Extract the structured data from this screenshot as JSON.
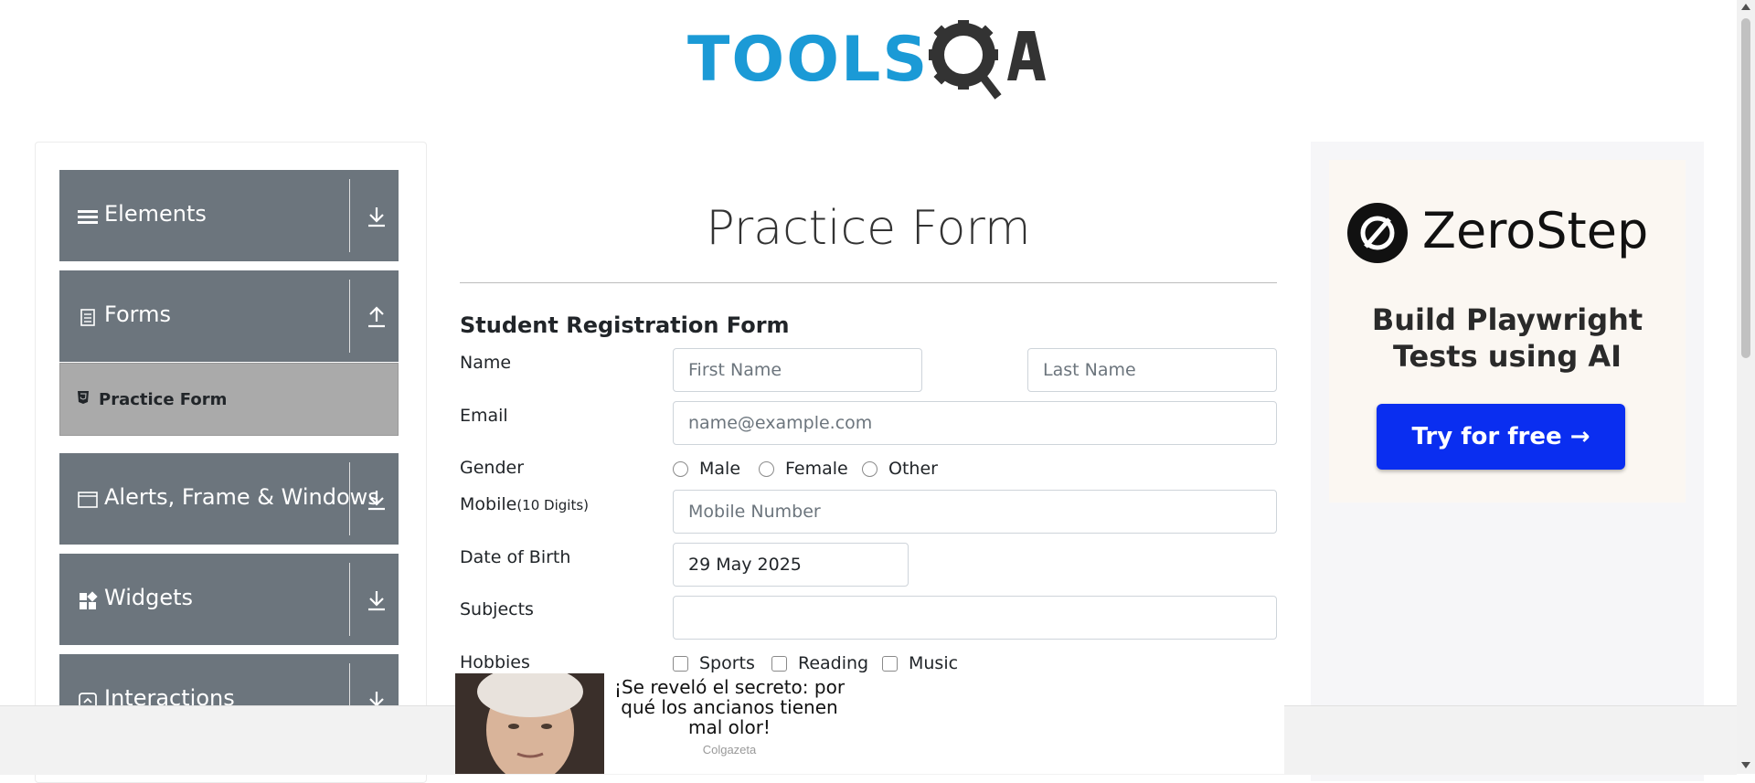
{
  "logo": {
    "text_left": "TOOLS",
    "text_right": "QA"
  },
  "sidebar": {
    "groups": [
      {
        "label": "Elements",
        "icon": "menu-icon",
        "arrow": "download-arrow-icon"
      },
      {
        "label": "Forms",
        "icon": "document-icon",
        "arrow": "upload-arrow-icon"
      },
      {
        "label": "Alerts, Frame & Windows",
        "icon": "window-icon",
        "arrow": "download-arrow-icon"
      },
      {
        "label": "Widgets",
        "icon": "widgets-icon",
        "arrow": "download-arrow-icon"
      },
      {
        "label": "Interactions",
        "icon": "interactions-icon",
        "arrow": "download-arrow-icon"
      }
    ],
    "active_item": {
      "label": "Practice Form",
      "icon": "html5-icon"
    }
  },
  "main": {
    "title": "Practice Form",
    "form_title": "Student Registration Form",
    "name_label": "Name",
    "first_name_placeholder": "First Name",
    "last_name_placeholder": "Last Name",
    "email_label": "Email",
    "email_placeholder": "name@example.com",
    "gender_label": "Gender",
    "gender_options": [
      "Male",
      "Female",
      "Other"
    ],
    "mobile_label": "Mobile",
    "mobile_hint": "(10 Digits)",
    "mobile_placeholder": "Mobile Number",
    "dob_label": "Date of Birth",
    "dob_value": "29 May 2025",
    "subjects_label": "Subjects",
    "subjects_value": "",
    "hobbies_label": "Hobbies",
    "hobbies_options": [
      "Sports",
      "Reading",
      "Music"
    ]
  },
  "ad_right": {
    "brand": "ZeroStep",
    "tagline_line1": "Build Playwright",
    "tagline_line2": "Tests using AI",
    "cta": "Try for free →"
  },
  "native_ad": {
    "headline": "¡Se reveló el secreto: por qué los ancianos tienen mal olor!",
    "source": "Colgazeta"
  },
  "colors": {
    "sidebar_group": "#6c757d",
    "active_item": "#aaaaaa",
    "logo_blue": "#1b9ad6",
    "logo_dark": "#333333",
    "cta_blue": "#0a2ef0"
  }
}
